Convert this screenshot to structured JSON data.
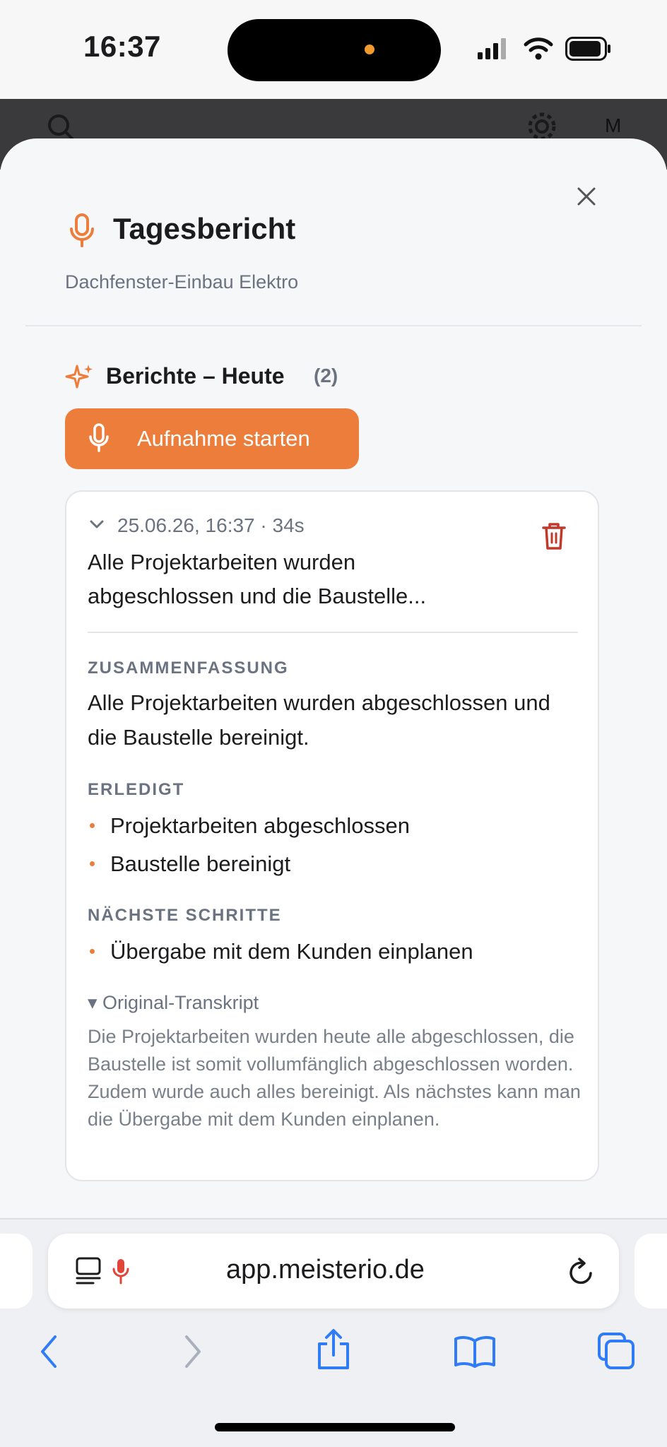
{
  "status_bar": {
    "time": "16:37"
  },
  "app_header": {
    "avatar_initial": "M"
  },
  "sheet": {
    "title": "Tagesbericht",
    "subtitle": "Dachfenster-Einbau Elektro",
    "section_title": "Berichte – Heute",
    "section_count": "(2)",
    "record_button_label": "Aufnahme starten"
  },
  "report": {
    "meta": "25.06.26, 16:37  · 34s",
    "preview_line1": "Alle Projektarbeiten wurden",
    "preview_line2": "abgeschlossen und die Baustelle...",
    "summary_label": "ZUSAMMENFASSUNG",
    "summary_text": "Alle Projektarbeiten wurden abgeschlossen und die Baustelle bereinigt.",
    "done_label": "ERLEDIGT",
    "done_items": [
      "Projektarbeiten abgeschlossen",
      "Baustelle bereinigt"
    ],
    "next_label": "NÄCHSTE SCHRITTE",
    "next_items": [
      "Übergabe mit dem Kunden einplanen"
    ],
    "transcript_toggle": "▾ Original-Transkript",
    "transcript_text": "Die Projektarbeiten wurden heute alle abgeschlossen, die Baustelle ist somit vollumfänglich abgeschlossen worden. Zudem wurde auch alles bereinigt. Als nächstes kann man die Übergabe mit dem Kunden einplanen."
  },
  "browser": {
    "url": "app.meisterio.de"
  },
  "colors": {
    "accent": "#ed7d3a",
    "danger": "#c0392b",
    "link_blue": "#2f7cf6"
  },
  "icons": [
    "search-icon",
    "gear-icon",
    "close-icon",
    "microphone-icon",
    "sparkle-icon",
    "chevron-down-icon",
    "trash-icon",
    "reader-icon",
    "reload-icon",
    "back-icon",
    "forward-icon",
    "share-icon",
    "bookmarks-icon",
    "tabs-icon"
  ]
}
